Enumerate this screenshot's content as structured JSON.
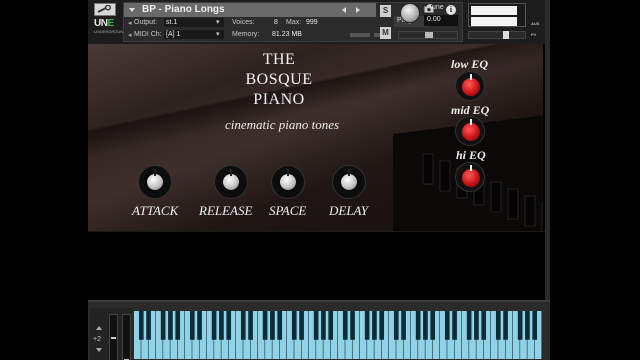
{
  "header": {
    "instrument_name": "BP - Piano Longs",
    "output_label": "Output:",
    "output_value": "st.1",
    "voices_label": "Voices:",
    "voices_value": "8",
    "max_label": "Max:",
    "max_value": "999",
    "purge_label": "Purge",
    "midi_label": "MIDI Ch:",
    "midi_value": "[A]  1",
    "memory_label": "Memory:",
    "memory_value": "81.23 MB",
    "solo_label": "S",
    "mute_label": "M",
    "tune_label": "Tune",
    "tune_value": "0.00",
    "aux_label": "AUX",
    "pv_label": "PV",
    "close_glyph": "x",
    "info_glyph": "i",
    "wrench_icon": "wrench-icon",
    "camera_icon": "camera-icon"
  },
  "logo": {
    "line1_a": "UN",
    "line1_b": "E",
    "line2": "UNDERGROUND"
  },
  "gui": {
    "title_line1": "THE",
    "title_line2": "BOSQUE",
    "title_line3": "PIANO",
    "subtitle": "cinematic piano tones",
    "knobs": [
      {
        "label": "ATTACK"
      },
      {
        "label": "RELEASE"
      },
      {
        "label": "SPACE"
      },
      {
        "label": "DELAY"
      }
    ],
    "eq": [
      {
        "label": "low EQ"
      },
      {
        "label": "mid EQ"
      },
      {
        "label": "hi EQ"
      }
    ]
  },
  "keyboard": {
    "octave_label": "+2",
    "key_color": "#8fd3e8",
    "black_key_color": "#0e2b36"
  },
  "colors": {
    "accent_red": "#c81414",
    "logo_green": "#3bb54a"
  }
}
